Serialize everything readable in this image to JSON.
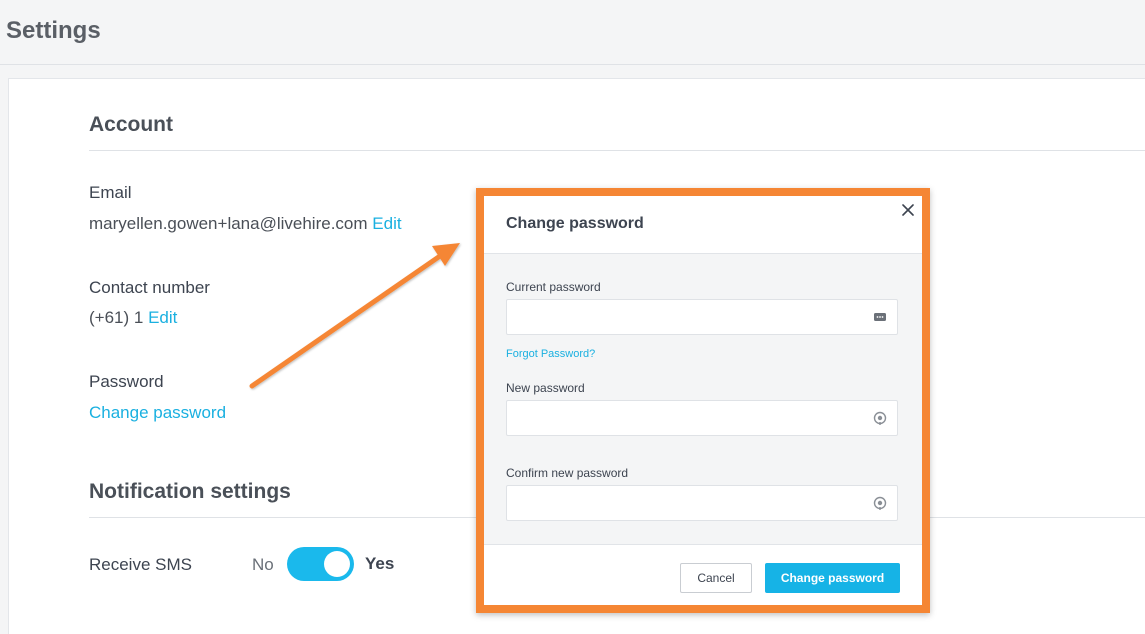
{
  "page": {
    "title": "Settings"
  },
  "account": {
    "title": "Account",
    "email_label": "Email",
    "email_value": "maryellen.gowen+lana@livehire.com",
    "email_edit": "Edit",
    "contact_label": "Contact number",
    "contact_value": "(+61) 1",
    "contact_edit": "Edit",
    "password_label": "Password",
    "password_link": "Change password"
  },
  "notifications": {
    "title": "Notification settings",
    "sms_label": "Receive SMS",
    "toggle_off_label": "No",
    "toggle_on_label": "Yes",
    "sms_enabled": true
  },
  "modal": {
    "title": "Change password",
    "current_label": "Current password",
    "current_value": "",
    "forgot_link": "Forgot Password?",
    "new_label": "New password",
    "new_value": "",
    "confirm_label": "Confirm new password",
    "confirm_value": "",
    "cancel_button": "Cancel",
    "submit_button": "Change password"
  },
  "colors": {
    "accent": "#1ab0e0",
    "annotation": "#f58634"
  },
  "icons": {
    "close": "close-icon",
    "password_manager": "password-manager-icon",
    "show_password": "eye-icon"
  }
}
